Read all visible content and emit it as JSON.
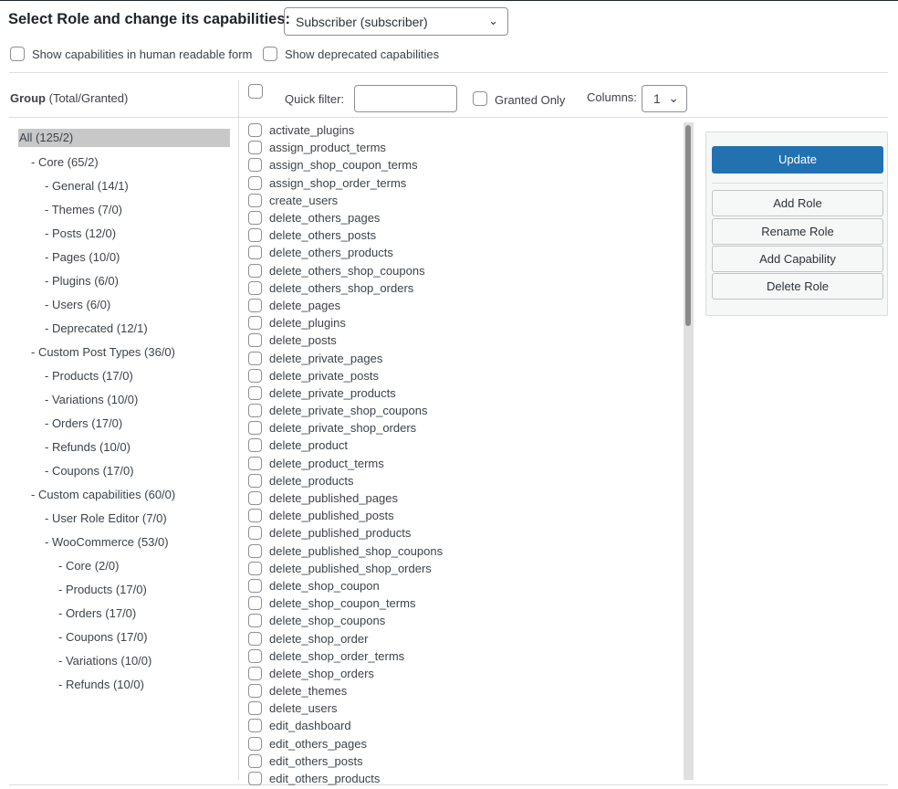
{
  "header": {
    "title": "Select Role and change its capabilities:",
    "role_selected": "Subscriber (subscriber)"
  },
  "options": {
    "human_readable": "Show capabilities in human readable form",
    "deprecated": "Show deprecated capabilities"
  },
  "group_header": {
    "bold": "Group",
    "rest": " (Total/Granted)"
  },
  "toolbar": {
    "quick_filter_label": "Quick filter:",
    "quick_filter_value": "",
    "granted_only": "Granted Only",
    "columns_label": "Columns:",
    "columns_value": "1"
  },
  "groups": [
    {
      "label": "All (125/2)",
      "level": 0,
      "selected": true
    },
    {
      "label": "- Core (65/2)",
      "level": 1
    },
    {
      "label": "- General (14/1)",
      "level": 2
    },
    {
      "label": "- Themes (7/0)",
      "level": 2
    },
    {
      "label": "- Posts (12/0)",
      "level": 2
    },
    {
      "label": "- Pages (10/0)",
      "level": 2
    },
    {
      "label": "- Plugins (6/0)",
      "level": 2
    },
    {
      "label": "- Users (6/0)",
      "level": 2
    },
    {
      "label": "- Deprecated (12/1)",
      "level": 2
    },
    {
      "label": "- Custom Post Types (36/0)",
      "level": 1
    },
    {
      "label": "- Products (17/0)",
      "level": 2
    },
    {
      "label": "- Variations (10/0)",
      "level": 2
    },
    {
      "label": "- Orders (17/0)",
      "level": 2
    },
    {
      "label": "- Refunds (10/0)",
      "level": 2
    },
    {
      "label": "- Coupons (17/0)",
      "level": 2
    },
    {
      "label": "- Custom capabilities (60/0)",
      "level": 1
    },
    {
      "label": "- User Role Editor (7/0)",
      "level": 2
    },
    {
      "label": "- WooCommerce (53/0)",
      "level": 2
    },
    {
      "label": "- Core (2/0)",
      "level": 3
    },
    {
      "label": "- Products (17/0)",
      "level": 3
    },
    {
      "label": "- Orders (17/0)",
      "level": 3
    },
    {
      "label": "- Coupons (17/0)",
      "level": 3
    },
    {
      "label": "- Variations (10/0)",
      "level": 3
    },
    {
      "label": "- Refunds (10/0)",
      "level": 3
    }
  ],
  "capabilities": [
    "activate_plugins",
    "assign_product_terms",
    "assign_shop_coupon_terms",
    "assign_shop_order_terms",
    "create_users",
    "delete_others_pages",
    "delete_others_posts",
    "delete_others_products",
    "delete_others_shop_coupons",
    "delete_others_shop_orders",
    "delete_pages",
    "delete_plugins",
    "delete_posts",
    "delete_private_pages",
    "delete_private_posts",
    "delete_private_products",
    "delete_private_shop_coupons",
    "delete_private_shop_orders",
    "delete_product",
    "delete_product_terms",
    "delete_products",
    "delete_published_pages",
    "delete_published_posts",
    "delete_published_products",
    "delete_published_shop_coupons",
    "delete_published_shop_orders",
    "delete_shop_coupon",
    "delete_shop_coupon_terms",
    "delete_shop_coupons",
    "delete_shop_order",
    "delete_shop_order_terms",
    "delete_shop_orders",
    "delete_themes",
    "delete_users",
    "edit_dashboard",
    "edit_others_pages",
    "edit_others_posts",
    "edit_others_products"
  ],
  "actions": {
    "update": "Update",
    "add_role": "Add Role",
    "rename_role": "Rename Role",
    "add_capability": "Add Capability",
    "delete_role": "Delete Role"
  },
  "colors": {
    "primary": "#2271b1"
  }
}
